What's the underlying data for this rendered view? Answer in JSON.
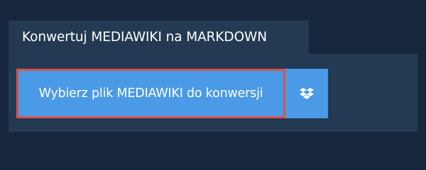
{
  "header": {
    "title": "Konwertuj MEDIAWIKI na MARKDOWN"
  },
  "actions": {
    "choose_file_label": "Wybierz plik MEDIAWIKI do konwersji",
    "dropbox_icon": "dropbox-icon"
  },
  "colors": {
    "background": "#15263d",
    "panel": "#243a52",
    "button": "#4a9ae5",
    "highlight_border": "#d9534f",
    "text": "#ffffff"
  }
}
